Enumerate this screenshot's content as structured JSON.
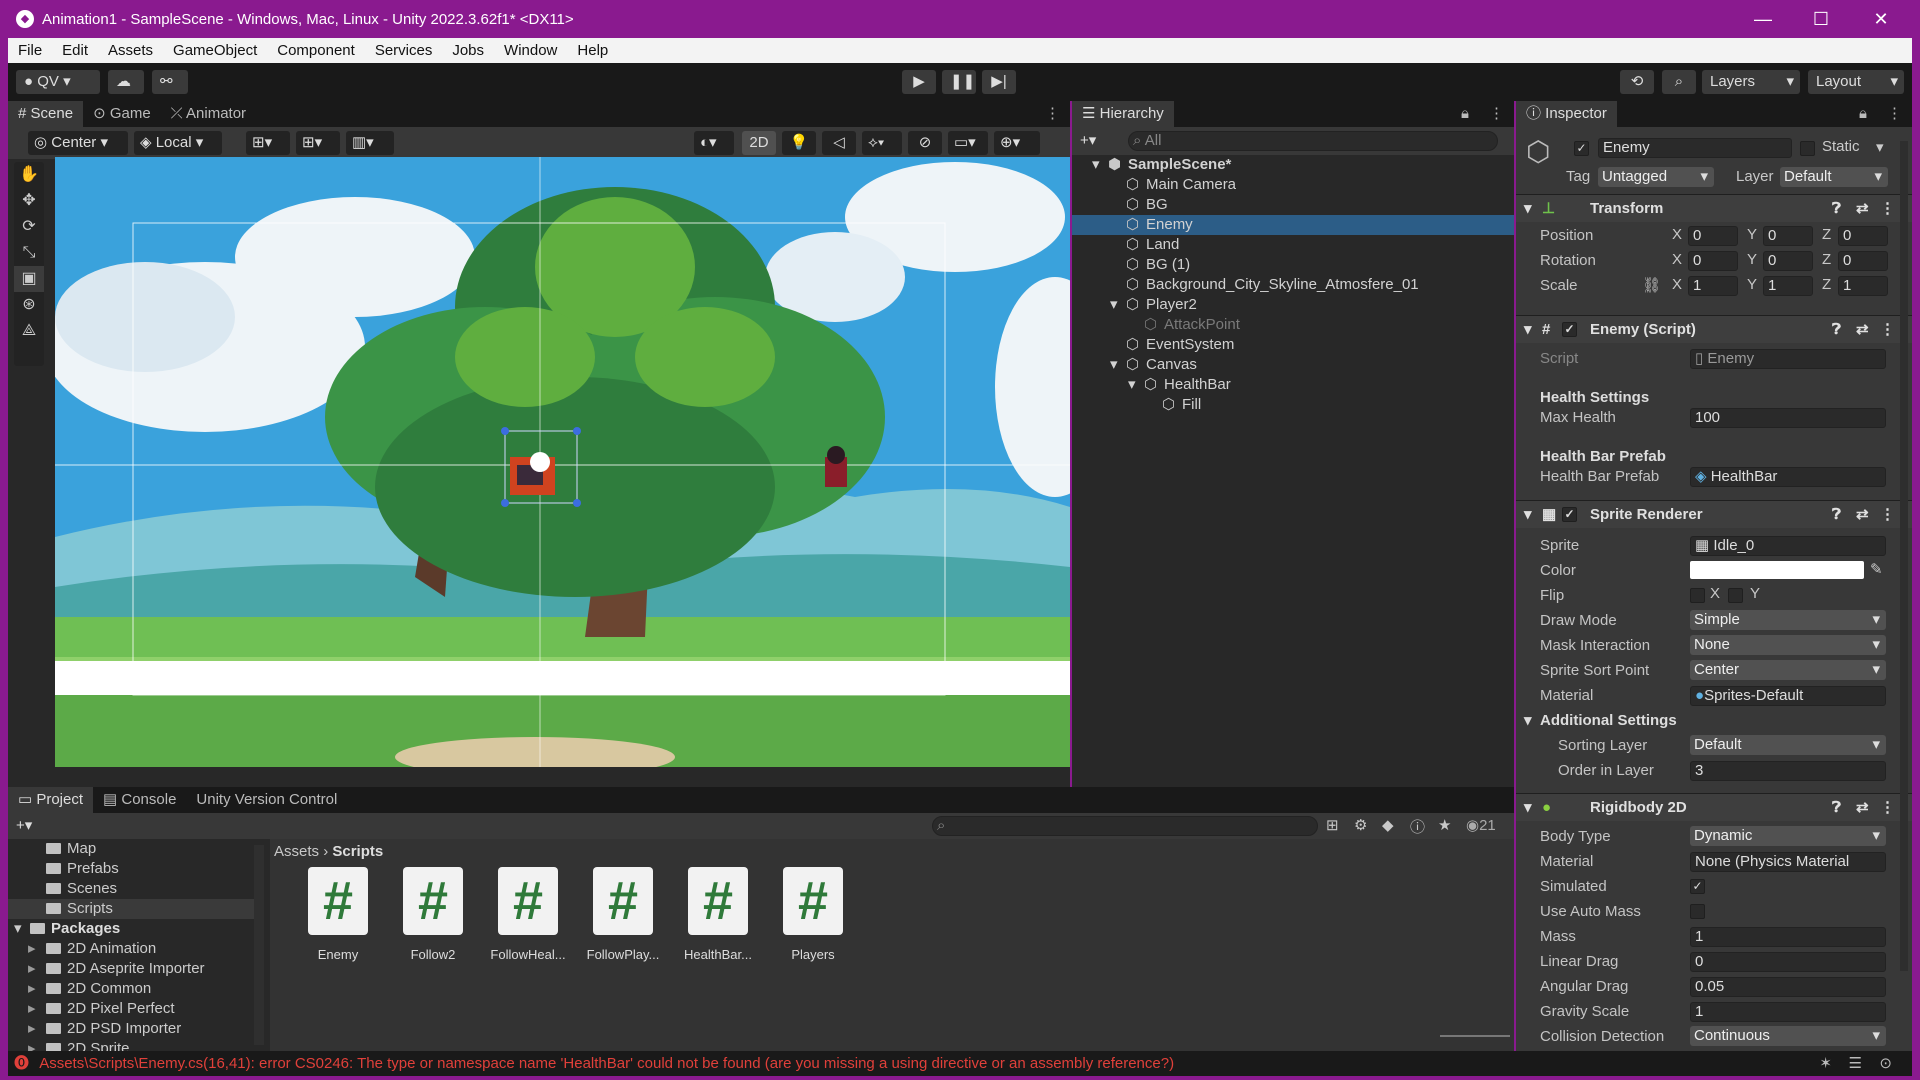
{
  "window": {
    "title": "Animation1 - SampleScene - Windows, Mac, Linux - Unity 2022.3.62f1* <DX11>"
  },
  "menu": [
    "File",
    "Edit",
    "Assets",
    "GameObject",
    "Component",
    "Services",
    "Jobs",
    "Window",
    "Help"
  ],
  "toolbar": {
    "account": "QV",
    "layers": "Layers",
    "layout": "Layout"
  },
  "left_tabs": [
    "Scene",
    "Game",
    "Animator"
  ],
  "scene_bar": {
    "pivot": "Center",
    "space": "Local",
    "mode_2d": "2D"
  },
  "hierarchy": {
    "title": "Hierarchy",
    "search": "All",
    "items": [
      {
        "label": "SampleScene*",
        "depth": 0,
        "expanded": true,
        "scene": true
      },
      {
        "label": "Main Camera",
        "depth": 1
      },
      {
        "label": "BG",
        "depth": 1
      },
      {
        "label": "Enemy",
        "depth": 1,
        "selected": true
      },
      {
        "label": "Land",
        "depth": 1
      },
      {
        "label": "BG (1)",
        "depth": 1
      },
      {
        "label": "Background_City_Skyline_Atmosfere_01",
        "depth": 1
      },
      {
        "label": "Player2",
        "depth": 1,
        "expanded": true
      },
      {
        "label": "AttackPoint",
        "depth": 2,
        "dim": true
      },
      {
        "label": "EventSystem",
        "depth": 1
      },
      {
        "label": "Canvas",
        "depth": 1,
        "expanded": true
      },
      {
        "label": "HealthBar",
        "depth": 2,
        "expanded": true
      },
      {
        "label": "Fill",
        "depth": 3
      }
    ]
  },
  "inspector": {
    "title": "Inspector",
    "object_name": "Enemy",
    "static_label": "Static",
    "tag_label": "Tag",
    "tag": "Untagged",
    "layer_label": "Layer",
    "layer": "Default",
    "transform": {
      "title": "Transform",
      "position": {
        "label": "Position",
        "x": "0",
        "y": "0",
        "z": "0"
      },
      "rotation": {
        "label": "Rotation",
        "x": "0",
        "y": "0",
        "z": "0"
      },
      "scale": {
        "label": "Scale",
        "x": "1",
        "y": "1",
        "z": "1"
      }
    },
    "enemy_script": {
      "title": "Enemy (Script)",
      "script_label": "Script",
      "script": "Enemy",
      "health_settings": "Health Settings",
      "max_health_label": "Max Health",
      "max_health": "100",
      "prefab_header": "Health Bar Prefab",
      "prefab_label": "Health Bar Prefab",
      "prefab": "HealthBar"
    },
    "sprite_renderer": {
      "title": "Sprite Renderer",
      "sprite_label": "Sprite",
      "sprite": "Idle_0",
      "color_label": "Color",
      "flip_label": "Flip",
      "flip_x": "X",
      "flip_y": "Y",
      "draw_mode_label": "Draw Mode",
      "draw_mode": "Simple",
      "mask_label": "Mask Interaction",
      "mask": "None",
      "sort_point_label": "Sprite Sort Point",
      "sort_point": "Center",
      "material_label": "Material",
      "material": "Sprites-Default",
      "additional": "Additional Settings",
      "sorting_layer_label": "Sorting Layer",
      "sorting_layer": "Default",
      "order_label": "Order in Layer",
      "order": "3"
    },
    "rigidbody": {
      "title": "Rigidbody 2D",
      "body_type_label": "Body Type",
      "body_type": "Dynamic",
      "material_label": "Material",
      "material": "None (Physics Material",
      "simulated_label": "Simulated",
      "auto_mass_label": "Use Auto Mass",
      "mass_label": "Mass",
      "mass": "1",
      "linear_drag_label": "Linear Drag",
      "linear_drag": "0",
      "angular_drag_label": "Angular Drag",
      "angular_drag": "0.05",
      "gravity_label": "Gravity Scale",
      "gravity": "1",
      "collision_label": "Collision Detection",
      "collision": "Continuous"
    }
  },
  "bottom_tabs": [
    "Project",
    "Console",
    "Unity Version Control"
  ],
  "project": {
    "count": "21",
    "breadcrumb": {
      "root": "Assets",
      "current": "Scripts"
    },
    "tree": [
      {
        "label": "Map",
        "depth": 1
      },
      {
        "label": "Prefabs",
        "depth": 1
      },
      {
        "label": "Scenes",
        "depth": 1
      },
      {
        "label": "Scripts",
        "depth": 1,
        "selected": true
      },
      {
        "label": "Packages",
        "depth": 0,
        "bold": true
      },
      {
        "label": "2D Animation",
        "depth": 1
      },
      {
        "label": "2D Aseprite Importer",
        "depth": 1
      },
      {
        "label": "2D Common",
        "depth": 1
      },
      {
        "label": "2D Pixel Perfect",
        "depth": 1
      },
      {
        "label": "2D PSD Importer",
        "depth": 1
      },
      {
        "label": "2D Sprite",
        "depth": 1
      }
    ],
    "assets": [
      "Enemy",
      "Follow2",
      "FollowHeal...",
      "FollowPlay...",
      "HealthBar...",
      "Players"
    ]
  },
  "status": {
    "error": "Assets\\Scripts\\Enemy.cs(16,41): error CS0246: The type or namespace name 'HealthBar' could not be found (are you missing a using directive or an assembly reference?)"
  },
  "colors": {
    "title": "#8a1a8f",
    "selection": "#2c5d87",
    "error": "#e0403a"
  }
}
